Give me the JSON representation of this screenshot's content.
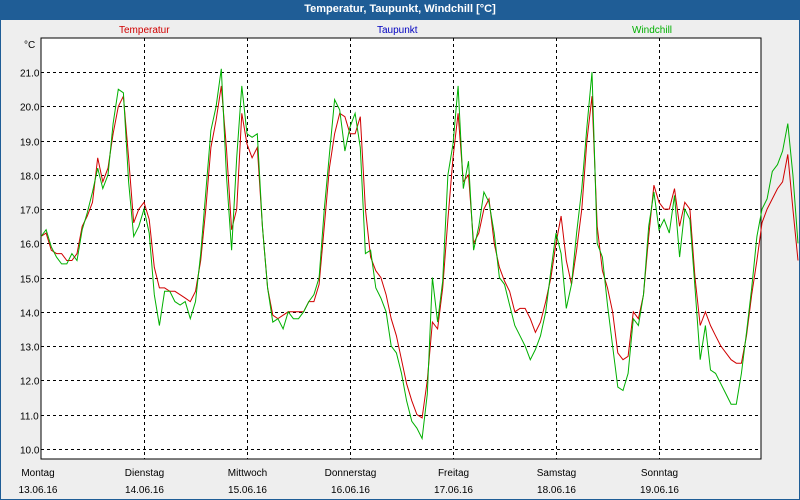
{
  "window": {
    "title": "Temperatur, Taupunkt, Windchill [°C]"
  },
  "colors": {
    "titlebar": "#1f5d96",
    "temperatur": "#d00000",
    "taupunkt": "#0000c0",
    "windchill": "#00b000",
    "grid": "#000000",
    "plot_bg": "#ffffff",
    "outer_bg": "#eeeeee"
  },
  "chart_data": {
    "type": "line",
    "title": "Temperatur, Taupunkt, Windchill [°C]",
    "ylabel": "°C",
    "ylim": [
      9.7,
      22.0
    ],
    "yticks": [
      10.0,
      11.0,
      12.0,
      13.0,
      14.0,
      15.0,
      16.0,
      17.0,
      18.0,
      19.0,
      20.0,
      21.0
    ],
    "xlim": [
      0,
      7.1
    ],
    "x_unit": "days",
    "x_ticks": [
      {
        "day": "Montag",
        "date": "13.06.16"
      },
      {
        "day": "Dienstag",
        "date": "14.06.16"
      },
      {
        "day": "Mittwoch",
        "date": "15.06.16"
      },
      {
        "day": "Donnerstag",
        "date": "16.06.16"
      },
      {
        "day": "Freitag",
        "date": "17.06.16"
      },
      {
        "day": "Samstag",
        "date": "18.06.16"
      },
      {
        "day": "Sonntag",
        "date": "19.06.16"
      }
    ],
    "legend": [
      "Temperatur",
      "Taupunkt",
      "Windchill"
    ],
    "grid": true,
    "series": [
      {
        "name": "Temperatur",
        "color": "#d00000",
        "points": [
          [
            0.0,
            16.2
          ],
          [
            0.05,
            16.3
          ],
          [
            0.1,
            15.8
          ],
          [
            0.15,
            15.7
          ],
          [
            0.2,
            15.7
          ],
          [
            0.25,
            15.5
          ],
          [
            0.3,
            15.5
          ],
          [
            0.35,
            15.7
          ],
          [
            0.4,
            16.5
          ],
          [
            0.45,
            16.8
          ],
          [
            0.5,
            17.2
          ],
          [
            0.55,
            18.5
          ],
          [
            0.6,
            17.8
          ],
          [
            0.65,
            18.2
          ],
          [
            0.7,
            19.2
          ],
          [
            0.75,
            20.0
          ],
          [
            0.8,
            20.3
          ],
          [
            0.85,
            18.5
          ],
          [
            0.9,
            16.6
          ],
          [
            0.95,
            17.0
          ],
          [
            1.0,
            17.2
          ],
          [
            1.05,
            16.7
          ],
          [
            1.1,
            15.3
          ],
          [
            1.15,
            14.7
          ],
          [
            1.2,
            14.7
          ],
          [
            1.25,
            14.6
          ],
          [
            1.3,
            14.6
          ],
          [
            1.35,
            14.5
          ],
          [
            1.4,
            14.4
          ],
          [
            1.45,
            14.3
          ],
          [
            1.5,
            14.6
          ],
          [
            1.55,
            15.5
          ],
          [
            1.6,
            17.0
          ],
          [
            1.65,
            18.8
          ],
          [
            1.7,
            19.6
          ],
          [
            1.75,
            20.6
          ],
          [
            1.8,
            18.8
          ],
          [
            1.85,
            16.4
          ],
          [
            1.9,
            17.0
          ],
          [
            1.95,
            19.8
          ],
          [
            2.0,
            18.9
          ],
          [
            2.05,
            18.5
          ],
          [
            2.1,
            18.8
          ],
          [
            2.15,
            16.5
          ],
          [
            2.2,
            14.7
          ],
          [
            2.25,
            13.9
          ],
          [
            2.3,
            13.8
          ],
          [
            2.35,
            13.9
          ],
          [
            2.4,
            14.0
          ],
          [
            2.45,
            14.0
          ],
          [
            2.5,
            14.0
          ],
          [
            2.55,
            14.0
          ],
          [
            2.6,
            14.3
          ],
          [
            2.65,
            14.3
          ],
          [
            2.7,
            14.8
          ],
          [
            2.75,
            16.5
          ],
          [
            2.8,
            18.2
          ],
          [
            2.85,
            19.2
          ],
          [
            2.9,
            19.8
          ],
          [
            2.95,
            19.7
          ],
          [
            3.0,
            19.2
          ],
          [
            3.05,
            19.2
          ],
          [
            3.1,
            19.7
          ],
          [
            3.15,
            17.0
          ],
          [
            3.2,
            15.6
          ],
          [
            3.25,
            15.2
          ],
          [
            3.3,
            15.0
          ],
          [
            3.35,
            14.5
          ],
          [
            3.4,
            13.8
          ],
          [
            3.45,
            13.3
          ],
          [
            3.5,
            12.6
          ],
          [
            3.55,
            11.9
          ],
          [
            3.6,
            11.4
          ],
          [
            3.65,
            11.0
          ],
          [
            3.7,
            10.9
          ],
          [
            3.75,
            12.0
          ],
          [
            3.8,
            13.7
          ],
          [
            3.85,
            13.5
          ],
          [
            3.9,
            14.7
          ],
          [
            3.95,
            16.7
          ],
          [
            4.0,
            18.5
          ],
          [
            4.05,
            19.8
          ],
          [
            4.1,
            17.8
          ],
          [
            4.15,
            18.0
          ],
          [
            4.2,
            16.0
          ],
          [
            4.25,
            16.3
          ],
          [
            4.3,
            17.0
          ],
          [
            4.35,
            17.3
          ],
          [
            4.4,
            16.0
          ],
          [
            4.45,
            15.3
          ],
          [
            4.5,
            14.9
          ],
          [
            4.55,
            14.6
          ],
          [
            4.6,
            14.0
          ],
          [
            4.65,
            14.1
          ],
          [
            4.7,
            14.1
          ],
          [
            4.75,
            13.8
          ],
          [
            4.8,
            13.4
          ],
          [
            4.85,
            13.7
          ],
          [
            4.9,
            14.3
          ],
          [
            4.95,
            15.0
          ],
          [
            5.0,
            16.0
          ],
          [
            5.05,
            16.8
          ],
          [
            5.1,
            15.5
          ],
          [
            5.15,
            14.8
          ],
          [
            5.2,
            15.8
          ],
          [
            5.25,
            17.0
          ],
          [
            5.3,
            19.0
          ],
          [
            5.35,
            20.3
          ],
          [
            5.4,
            16.5
          ],
          [
            5.45,
            15.2
          ],
          [
            5.5,
            14.7
          ],
          [
            5.55,
            14.0
          ],
          [
            5.6,
            12.8
          ],
          [
            5.65,
            12.6
          ],
          [
            5.7,
            12.7
          ],
          [
            5.75,
            14.0
          ],
          [
            5.8,
            13.8
          ],
          [
            5.85,
            14.5
          ],
          [
            5.9,
            16.2
          ],
          [
            5.95,
            17.7
          ],
          [
            6.0,
            17.2
          ],
          [
            6.05,
            17.0
          ],
          [
            6.1,
            17.0
          ],
          [
            6.15,
            17.6
          ],
          [
            6.2,
            16.5
          ],
          [
            6.25,
            17.2
          ],
          [
            6.3,
            17.0
          ],
          [
            6.35,
            15.0
          ],
          [
            6.4,
            13.6
          ],
          [
            6.45,
            14.0
          ],
          [
            6.5,
            13.6
          ],
          [
            6.55,
            13.3
          ],
          [
            6.6,
            13.0
          ],
          [
            6.65,
            12.8
          ],
          [
            6.7,
            12.6
          ],
          [
            6.75,
            12.5
          ],
          [
            6.8,
            12.5
          ],
          [
            6.85,
            13.3
          ],
          [
            6.9,
            14.5
          ],
          [
            6.95,
            15.5
          ],
          [
            7.0,
            16.6
          ],
          [
            7.05,
            17.0
          ],
          [
            7.1,
            17.3
          ],
          [
            7.15,
            17.6
          ],
          [
            7.2,
            17.8
          ],
          [
            7.25,
            18.6
          ],
          [
            7.3,
            17.0
          ],
          [
            7.35,
            15.5
          ]
        ]
      },
      {
        "name": "Windchill",
        "color": "#00b000",
        "points": [
          [
            0.0,
            16.2
          ],
          [
            0.05,
            16.4
          ],
          [
            0.1,
            15.9
          ],
          [
            0.15,
            15.6
          ],
          [
            0.2,
            15.4
          ],
          [
            0.25,
            15.4
          ],
          [
            0.3,
            15.7
          ],
          [
            0.35,
            15.5
          ],
          [
            0.4,
            16.4
          ],
          [
            0.45,
            16.9
          ],
          [
            0.5,
            17.5
          ],
          [
            0.55,
            18.2
          ],
          [
            0.6,
            17.6
          ],
          [
            0.65,
            18.0
          ],
          [
            0.7,
            19.5
          ],
          [
            0.75,
            20.5
          ],
          [
            0.8,
            20.4
          ],
          [
            0.85,
            17.8
          ],
          [
            0.9,
            16.2
          ],
          [
            0.95,
            16.5
          ],
          [
            1.0,
            17.0
          ],
          [
            1.05,
            16.3
          ],
          [
            1.1,
            14.5
          ],
          [
            1.15,
            13.6
          ],
          [
            1.2,
            14.6
          ],
          [
            1.25,
            14.6
          ],
          [
            1.3,
            14.3
          ],
          [
            1.35,
            14.2
          ],
          [
            1.4,
            14.3
          ],
          [
            1.45,
            13.8
          ],
          [
            1.5,
            14.3
          ],
          [
            1.55,
            15.7
          ],
          [
            1.6,
            17.5
          ],
          [
            1.65,
            19.3
          ],
          [
            1.7,
            20.0
          ],
          [
            1.75,
            21.1
          ],
          [
            1.8,
            18.0
          ],
          [
            1.85,
            15.8
          ],
          [
            1.9,
            18.5
          ],
          [
            1.95,
            20.6
          ],
          [
            2.0,
            19.2
          ],
          [
            2.05,
            19.1
          ],
          [
            2.1,
            19.2
          ],
          [
            2.15,
            16.5
          ],
          [
            2.2,
            14.7
          ],
          [
            2.25,
            13.7
          ],
          [
            2.3,
            13.8
          ],
          [
            2.35,
            13.5
          ],
          [
            2.4,
            14.0
          ],
          [
            2.45,
            13.8
          ],
          [
            2.5,
            13.8
          ],
          [
            2.55,
            14.0
          ],
          [
            2.6,
            14.3
          ],
          [
            2.65,
            14.5
          ],
          [
            2.7,
            15.0
          ],
          [
            2.75,
            17.0
          ],
          [
            2.8,
            18.6
          ],
          [
            2.85,
            20.2
          ],
          [
            2.9,
            19.9
          ],
          [
            2.95,
            18.7
          ],
          [
            3.0,
            19.4
          ],
          [
            3.05,
            19.8
          ],
          [
            3.1,
            18.8
          ],
          [
            3.15,
            15.7
          ],
          [
            3.2,
            15.8
          ],
          [
            3.25,
            14.7
          ],
          [
            3.3,
            14.4
          ],
          [
            3.35,
            14.0
          ],
          [
            3.4,
            13.0
          ],
          [
            3.45,
            12.8
          ],
          [
            3.5,
            12.2
          ],
          [
            3.55,
            11.4
          ],
          [
            3.6,
            10.8
          ],
          [
            3.65,
            10.6
          ],
          [
            3.7,
            10.3
          ],
          [
            3.75,
            11.6
          ],
          [
            3.8,
            15.0
          ],
          [
            3.85,
            13.7
          ],
          [
            3.9,
            14.9
          ],
          [
            3.95,
            18.0
          ],
          [
            4.0,
            18.9
          ],
          [
            4.05,
            20.6
          ],
          [
            4.1,
            17.6
          ],
          [
            4.15,
            18.4
          ],
          [
            4.2,
            15.8
          ],
          [
            4.25,
            16.5
          ],
          [
            4.3,
            17.5
          ],
          [
            4.35,
            17.2
          ],
          [
            4.4,
            16.3
          ],
          [
            4.45,
            15.0
          ],
          [
            4.5,
            14.8
          ],
          [
            4.55,
            14.2
          ],
          [
            4.6,
            13.6
          ],
          [
            4.65,
            13.3
          ],
          [
            4.7,
            13.0
          ],
          [
            4.75,
            12.6
          ],
          [
            4.8,
            12.9
          ],
          [
            4.85,
            13.3
          ],
          [
            4.9,
            14.0
          ],
          [
            4.95,
            15.2
          ],
          [
            5.0,
            16.3
          ],
          [
            5.05,
            15.7
          ],
          [
            5.1,
            14.1
          ],
          [
            5.15,
            14.8
          ],
          [
            5.2,
            16.3
          ],
          [
            5.25,
            17.6
          ],
          [
            5.3,
            19.4
          ],
          [
            5.35,
            21.0
          ],
          [
            5.4,
            16.0
          ],
          [
            5.45,
            15.6
          ],
          [
            5.5,
            14.2
          ],
          [
            5.55,
            13.0
          ],
          [
            5.6,
            11.8
          ],
          [
            5.65,
            11.7
          ],
          [
            5.7,
            12.2
          ],
          [
            5.75,
            13.8
          ],
          [
            5.8,
            13.6
          ],
          [
            5.85,
            14.5
          ],
          [
            5.9,
            16.5
          ],
          [
            5.95,
            17.5
          ],
          [
            6.0,
            16.4
          ],
          [
            6.05,
            16.7
          ],
          [
            6.1,
            16.3
          ],
          [
            6.15,
            17.4
          ],
          [
            6.2,
            15.6
          ],
          [
            6.25,
            17.0
          ],
          [
            6.3,
            16.7
          ],
          [
            6.35,
            14.7
          ],
          [
            6.4,
            12.6
          ],
          [
            6.45,
            13.6
          ],
          [
            6.5,
            12.3
          ],
          [
            6.55,
            12.2
          ],
          [
            6.6,
            11.9
          ],
          [
            6.65,
            11.6
          ],
          [
            6.7,
            11.3
          ],
          [
            6.75,
            11.3
          ],
          [
            6.8,
            12.2
          ],
          [
            6.85,
            13.4
          ],
          [
            6.9,
            14.7
          ],
          [
            6.95,
            16.2
          ],
          [
            7.0,
            17.0
          ],
          [
            7.05,
            17.3
          ],
          [
            7.1,
            18.1
          ],
          [
            7.15,
            18.3
          ],
          [
            7.2,
            18.7
          ],
          [
            7.25,
            19.5
          ],
          [
            7.3,
            18.0
          ],
          [
            7.35,
            16.0
          ]
        ]
      }
    ]
  }
}
